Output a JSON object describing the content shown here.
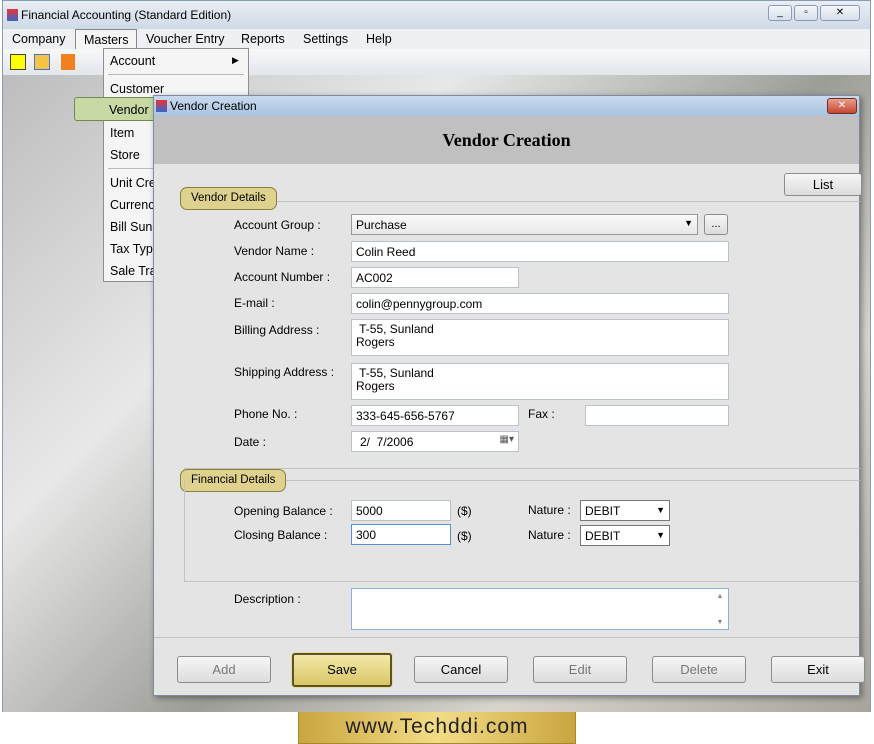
{
  "app": {
    "title": "Financial Accounting (Standard Edition)"
  },
  "menu": [
    "Company",
    "Masters",
    "Voucher Entry",
    "Reports",
    "Settings",
    "Help"
  ],
  "masters_menu": {
    "items": [
      "Account",
      "Customer",
      "Vendor",
      "Item",
      "Store",
      "Unit Cre",
      "Currency",
      "Bill Sund",
      "Tax Type",
      "Sale Tra"
    ],
    "highlighted": "Vendor"
  },
  "dialog": {
    "window_title": "Vendor Creation",
    "heading": "Vendor Creation",
    "list_button": "List",
    "vendor_details": {
      "group_label": "Vendor Details",
      "account_group_label": "Account Group :",
      "account_group": "Purchase",
      "browse_button": "...",
      "vendor_name_label": "Vendor Name :",
      "vendor_name": "Colin Reed",
      "account_number_label": "Account Number :",
      "account_number": "AC002",
      "email_label": "E-mail :",
      "email": "colin@pennygroup.com",
      "billing_label": "Billing Address :",
      "billing": " T-55, Sunland\nRogers",
      "shipping_label": "Shipping Address :",
      "shipping": " T-55, Sunland\nRogers",
      "phone_label": "Phone No. :",
      "phone": "333-645-656-5767",
      "fax_label": "Fax :",
      "fax": "",
      "date_label": "Date :",
      "date": "2/  7/2006"
    },
    "financial_details": {
      "group_label": "Financial Details",
      "opening_label": "Opening Balance :",
      "opening": "5000",
      "opening_unit": "($)",
      "closing_label": "Closing Balance :",
      "closing": "300",
      "closing_unit": "($)",
      "nature_label": "Nature :",
      "opening_nature": "DEBIT",
      "closing_nature": "DEBIT"
    },
    "description_label": "Description :",
    "description": "",
    "buttons": {
      "add": "Add",
      "save": "Save",
      "cancel": "Cancel",
      "edit": "Edit",
      "delete": "Delete",
      "exit": "Exit"
    }
  },
  "footer": {
    "brand": "www.Techddi.com"
  }
}
